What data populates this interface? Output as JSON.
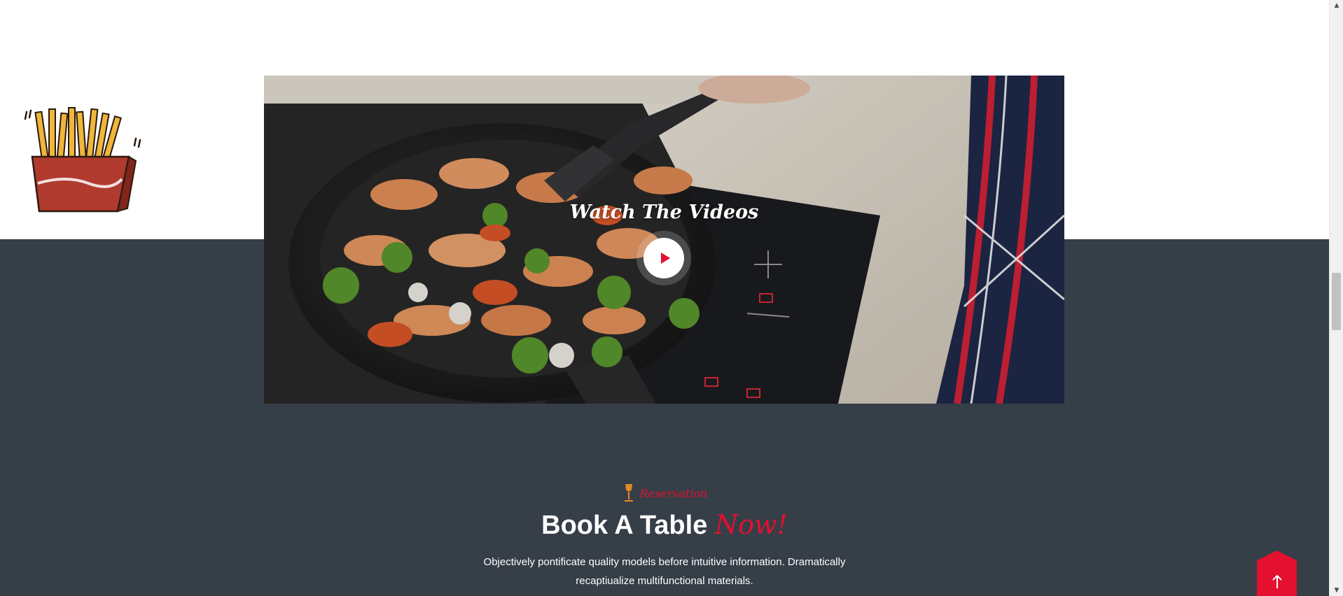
{
  "video": {
    "title": "Watch The Videos"
  },
  "reservation": {
    "label": "Reservation",
    "title_main": "Book A Table",
    "title_accent": "Now!",
    "description": "Objectively pontificate quality models before intuitive information. Dramatically recaptiualize multifunctional materials."
  },
  "icons": {
    "decoration": "french-fries-icon",
    "play": "play-icon",
    "reservation": "wine-glass-icon",
    "back_to_top": "arrow-up-icon"
  },
  "colors": {
    "accent": "#e3102f",
    "dark_section": "#363e48",
    "glass_icon": "#e58a1f"
  }
}
